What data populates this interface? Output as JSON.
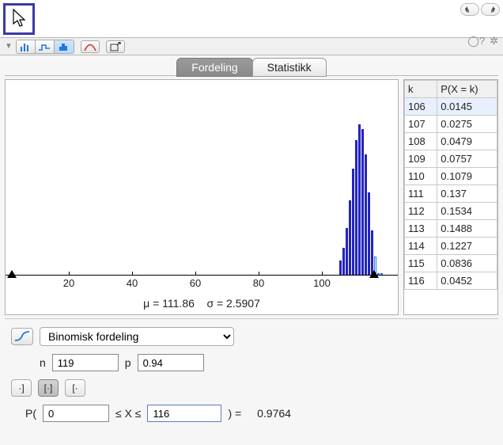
{
  "tabs": {
    "dist": "Fordeling",
    "stat": "Statistikk"
  },
  "table": {
    "col_k": "k",
    "col_p": "P(X = k)"
  },
  "chart_data": {
    "type": "bar",
    "title": "",
    "xlabel": "",
    "ylabel": "",
    "x_ticks": [
      20,
      40,
      60,
      80,
      100
    ],
    "xlim": [
      0,
      120
    ],
    "k": [
      106,
      107,
      108,
      109,
      110,
      111,
      112,
      113,
      114,
      115,
      116,
      117,
      118,
      119
    ],
    "pmf": [
      0.0145,
      0.0275,
      0.0479,
      0.0757,
      0.1079,
      0.137,
      0.1534,
      0.1488,
      0.1227,
      0.0836,
      0.0452,
      0.0189,
      0.0006,
      0.0001
    ],
    "table_rows": [
      {
        "k": "106",
        "p": "0.0145"
      },
      {
        "k": "107",
        "p": "0.0275"
      },
      {
        "k": "108",
        "p": "0.0479"
      },
      {
        "k": "109",
        "p": "0.0757"
      },
      {
        "k": "110",
        "p": "0.1079"
      },
      {
        "k": "111",
        "p": "0.137"
      },
      {
        "k": "112",
        "p": "0.1534"
      },
      {
        "k": "113",
        "p": "0.1488"
      },
      {
        "k": "114",
        "p": "0.1227"
      },
      {
        "k": "115",
        "p": "0.0836"
      },
      {
        "k": "116",
        "p": "0.0452"
      }
    ],
    "mu_label": "μ = 111.86",
    "sigma_label": "σ = 2.5907"
  },
  "dist": {
    "selected": "Binomisk fordeling",
    "n_label": "n",
    "n_value": "119",
    "p_label": "p",
    "p_value": "0.94"
  },
  "prob": {
    "open": "P(",
    "lo": "0",
    "mid": " ≤ X ≤ ",
    "hi": "116",
    "close": ") =",
    "result": "0.9764"
  }
}
